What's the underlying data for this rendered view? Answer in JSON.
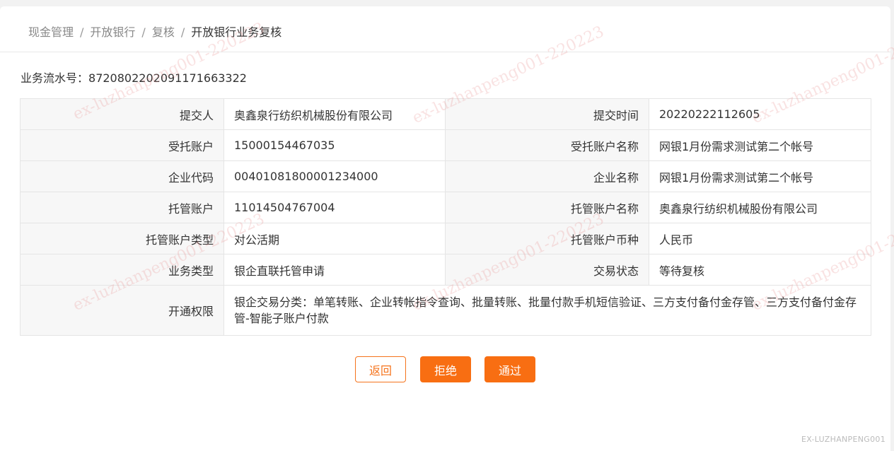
{
  "breadcrumb": {
    "items": [
      "现金管理",
      "开放银行",
      "复核"
    ],
    "current": "开放银行业务复核",
    "separator": "/"
  },
  "serial": {
    "label": "业务流水号：",
    "value": "87208022020911716633​22"
  },
  "details": {
    "submitter_label": "提交人",
    "submitter": "奥鑫泉行纺织机械股份有限公司",
    "submit_time_label": "提交时间",
    "submit_time": "20220222112605",
    "trust_account_label": "受托账户",
    "trust_account": "15000154467035",
    "trust_account_name_label": "受托账户名称",
    "trust_account_name": "网银1月份需求测试第二个帐号",
    "company_code_label": "企业代码",
    "company_code": "00401081800001234000",
    "company_name_label": "企业名称",
    "company_name": "网银1月份需求测试第二个帐号",
    "custody_account_label": "托管账户",
    "custody_account": "11014504767004",
    "custody_account_name_label": "托管账户名称",
    "custody_account_name": "奥鑫泉行纺织机械股份有限公司",
    "custody_account_type_label": "托管账户类型",
    "custody_account_type": "对公活期",
    "custody_currency_label": "托管账户币种",
    "custody_currency": "人民币",
    "business_type_label": "业务类型",
    "business_type": "银企直联托管申请",
    "trade_status_label": "交易状态",
    "trade_status": "等待复核",
    "permissions_label": "开通权限",
    "permissions": "银企交易分类：单笔转账、企业转帐指令查询、批量转账、批量付款手机短信验证、三方支付备付金存管、三方支付备付金存管-智能子账户付款"
  },
  "actions": {
    "back": "返回",
    "reject": "拒绝",
    "pass": "通过"
  },
  "watermark": {
    "text": "ex-luzhanpeng001-220223",
    "footer": "EX-LUZHANPENG001"
  },
  "colors": {
    "accent": "#f86e12",
    "label_bg": "#f7f7f7",
    "border": "#e5e5e5"
  }
}
